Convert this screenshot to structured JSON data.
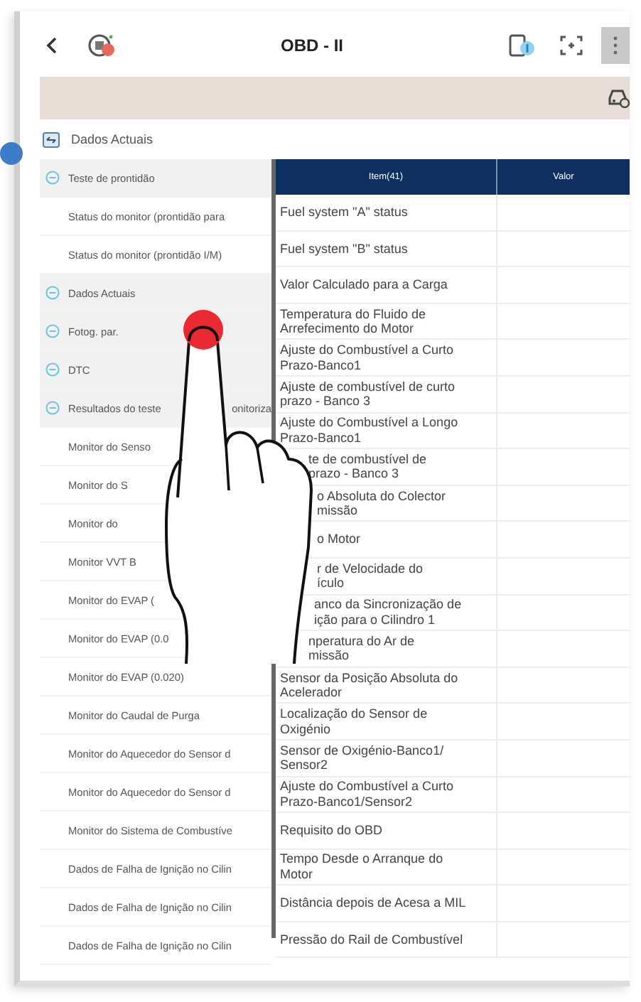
{
  "header": {
    "title": "OBD - II"
  },
  "breadcrumb": {
    "label": "Dados Actuais"
  },
  "tree": [
    {
      "kind": "category",
      "label": "Teste de prontidão",
      "expanded": true
    },
    {
      "kind": "item",
      "label": "Status do monitor (prontidão para"
    },
    {
      "kind": "item",
      "label": "Status do monitor (prontidão I/M)"
    },
    {
      "kind": "category",
      "label": "Dados Actuais",
      "expanded": true
    },
    {
      "kind": "category",
      "label": "Fotog. par.",
      "expanded": true
    },
    {
      "kind": "category",
      "label": "DTC",
      "expanded": true
    },
    {
      "kind": "category",
      "label": "Resultados do teste",
      "tail": "onitoriza",
      "expanded": true
    },
    {
      "kind": "item",
      "label": "Monitor do Senso"
    },
    {
      "kind": "item",
      "label": "Monitor do S"
    },
    {
      "kind": "item",
      "label": "Monitor do"
    },
    {
      "kind": "item",
      "label": "Monitor VVT B"
    },
    {
      "kind": "item",
      "label": "Monitor do EVAP ("
    },
    {
      "kind": "item",
      "label": "Monitor do EVAP (0.0"
    },
    {
      "kind": "item",
      "label": "Monitor do EVAP (0.020)"
    },
    {
      "kind": "item",
      "label": "Monitor do Caudal de Purga"
    },
    {
      "kind": "item",
      "label": "Monitor do Aquecedor do Sensor d"
    },
    {
      "kind": "item",
      "label": "Monitor do Aquecedor do Sensor d"
    },
    {
      "kind": "item",
      "label": "Monitor do Sistema de Combustíve"
    },
    {
      "kind": "item",
      "label": "Dados de Falha de Ignição no Cilin"
    },
    {
      "kind": "item",
      "label": "Dados de Falha de Ignição no Cilin"
    },
    {
      "kind": "item",
      "label": "Dados de Falha de Ignição no Cilin"
    }
  ],
  "table": {
    "columns": [
      "Item(41)",
      "Valor"
    ],
    "rows": [
      {
        "item": "Fuel system \"A\" status"
      },
      {
        "item": "Fuel system \"B\" status"
      },
      {
        "item": "Valor Calculado para a Carga"
      },
      {
        "item": "Temperatura do Fluido de Arrefecimento do Motor"
      },
      {
        "item": "Ajuste do Combustível a Curto Prazo-Banco1"
      },
      {
        "item": "Ajuste de combustível de curto prazo - Banco 3"
      },
      {
        "item": "Ajuste do Combustível a Longo Prazo-Banco1"
      },
      {
        "item": "te de combustível de",
        "item_2": "prazo - Banco 3"
      },
      {
        "item": "o Absoluta do Colector",
        "item_2": "missão"
      },
      {
        "item": "o Motor"
      },
      {
        "item": "r de Velocidade do",
        "item_2": "ículo"
      },
      {
        "item": "anco da Sincronização de",
        "item_2": "ição para o Cilindro 1"
      },
      {
        "item": "nperatura do Ar de",
        "item_2": "missão"
      },
      {
        "item": "Sensor da Posição Absoluta do Acelerador"
      },
      {
        "item": "Localização do Sensor de Oxigénio"
      },
      {
        "item": "Sensor de Oxigénio-Banco1/ Sensor2"
      },
      {
        "item": "Ajuste do Combustível a Curto Prazo-Banco1/Sensor2"
      },
      {
        "item": "Requisito do OBD"
      },
      {
        "item": "Tempo Desde o Arranque do Motor"
      },
      {
        "item": "Distância depois de Acesa a MIL"
      },
      {
        "item": "Pressão do Rail de Combustível"
      }
    ]
  }
}
